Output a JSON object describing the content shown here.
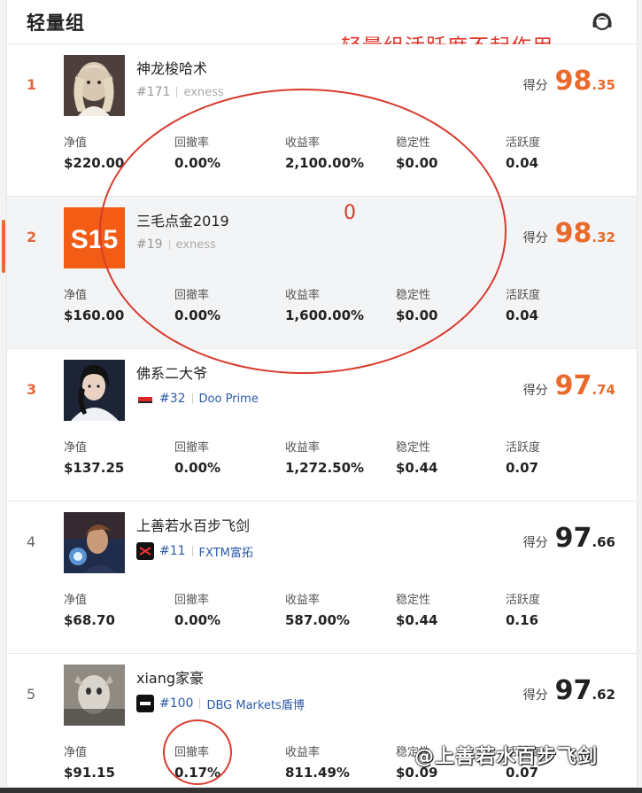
{
  "header": {
    "title": "轻量组",
    "annotation": "轻量组活跃度不起作用"
  },
  "labels": {
    "score": "得分",
    "net_value": "净值",
    "drawdown": "回撤率",
    "return_rate": "收益率",
    "stability": "稳定性",
    "activity": "活跃度"
  },
  "rows": [
    {
      "rank": "1",
      "name": "神龙梭哈术",
      "id": "#171",
      "broker": "exness",
      "score_int": "98",
      "score_dec": ".35",
      "net_value": "$220.00",
      "drawdown": "0.00%",
      "return_rate": "2,100.00%",
      "stability": "$0.00",
      "activity": "0.04"
    },
    {
      "rank": "2",
      "name": "三毛点金2019",
      "id": "#19",
      "broker": "exness",
      "avatar_text": "S15",
      "score_int": "98",
      "score_dec": ".32",
      "net_value": "$160.00",
      "drawdown": "0.00%",
      "return_rate": "1,600.00%",
      "stability": "$0.00",
      "activity": "0.04"
    },
    {
      "rank": "3",
      "name": "佛系二大爷",
      "id": "#32",
      "broker": "Doo Prime",
      "score_int": "97",
      "score_dec": ".74",
      "net_value": "$137.25",
      "drawdown": "0.00%",
      "return_rate": "1,272.50%",
      "stability": "$0.44",
      "activity": "0.07"
    },
    {
      "rank": "4",
      "name": "上善若水百步飞剑",
      "id": "#11",
      "broker": "FXTM富拓",
      "score_int": "97",
      "score_dec": ".66",
      "net_value": "$68.70",
      "drawdown": "0.00%",
      "return_rate": "587.00%",
      "stability": "$0.44",
      "activity": "0.16"
    },
    {
      "rank": "5",
      "name": "xiang家豪",
      "id": "#100",
      "broker": "DBG Markets盾博",
      "score_int": "97",
      "score_dec": ".62",
      "net_value": "$91.15",
      "drawdown": "0.17%",
      "return_rate": "811.49%",
      "stability": "$0.09",
      "activity": "0.07"
    }
  ],
  "annotations": {
    "zero_mark": "0",
    "watermark": "@上善若水百步飞剑"
  },
  "colors": {
    "accent": "#ea6a2c",
    "annotation_red": "#d93a2e",
    "broker_link": "#2b5aa8",
    "row_highlight": "#f3f4f6"
  }
}
